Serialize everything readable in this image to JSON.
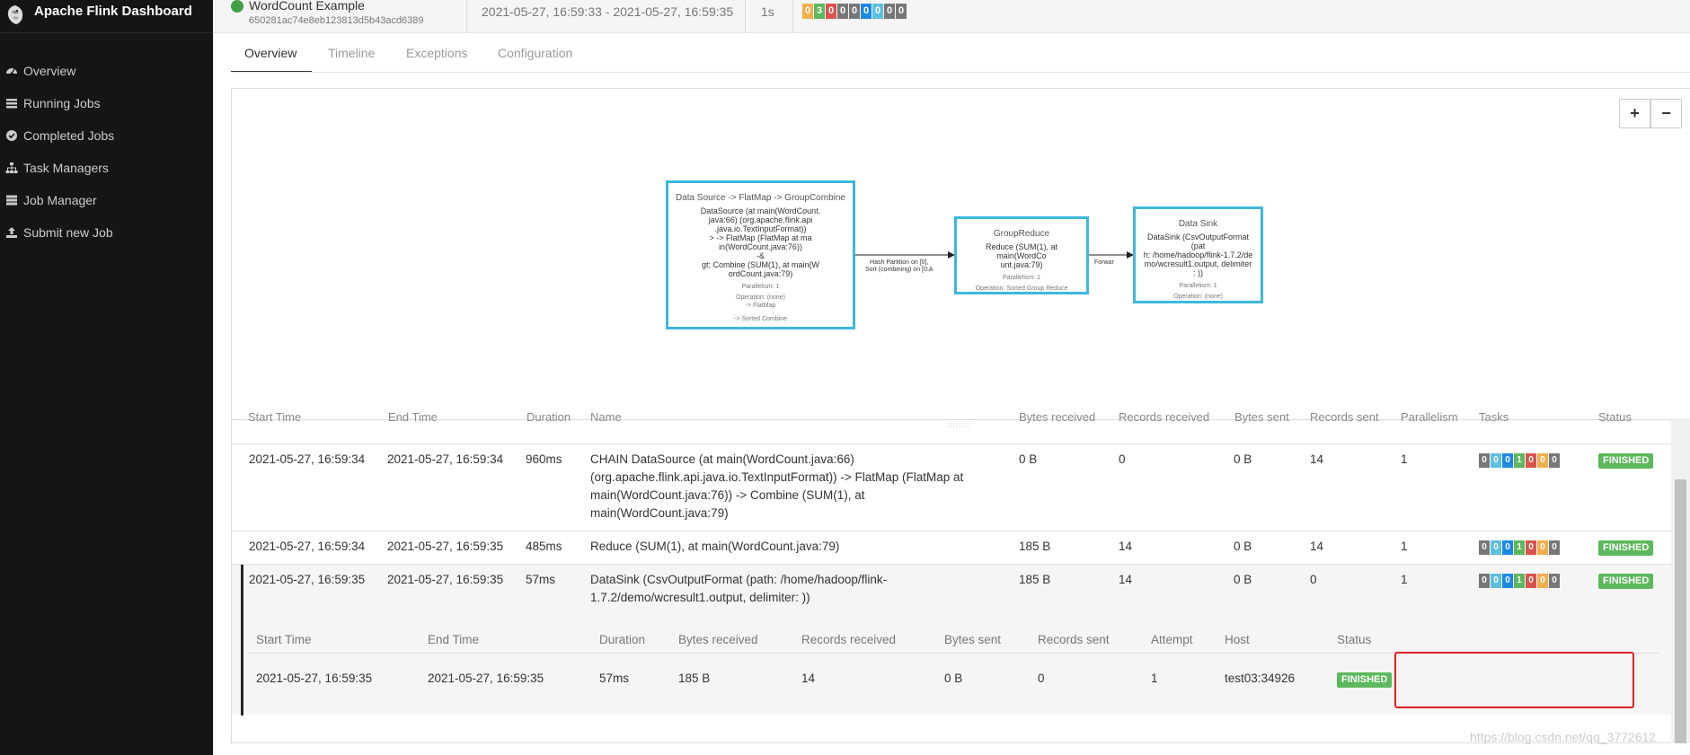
{
  "app": {
    "title": "Apache Flink Dashboard"
  },
  "sidebar": {
    "items": [
      {
        "label": "Overview",
        "icon": "dashboard-icon"
      },
      {
        "label": "Running Jobs",
        "icon": "tasks-icon"
      },
      {
        "label": "Completed Jobs",
        "icon": "check-circle-icon"
      },
      {
        "label": "Task Managers",
        "icon": "sitemap-icon"
      },
      {
        "label": "Job Manager",
        "icon": "server-icon"
      },
      {
        "label": "Submit new Job",
        "icon": "upload-icon"
      }
    ]
  },
  "job": {
    "name": "WordCount Example",
    "id": "650281ac74e8eb123813d5b43acd6389",
    "time_range": "2021-05-27, 16:59:33 - 2021-05-27, 16:59:35",
    "duration": "1s",
    "status_color": "#43a047",
    "counts": [
      {
        "value": "0",
        "color": "#f0ad4e"
      },
      {
        "value": "3",
        "color": "#5cb85c"
      },
      {
        "value": "0",
        "color": "#d9534f"
      },
      {
        "value": "0",
        "color": "#777777"
      },
      {
        "value": "0",
        "color": "#777777"
      },
      {
        "value": "0",
        "color": "#1e88e5"
      },
      {
        "value": "0",
        "color": "#5bc0de"
      },
      {
        "value": "0",
        "color": "#777777"
      },
      {
        "value": "0",
        "color": "#777777"
      }
    ]
  },
  "tabs": [
    {
      "label": "Overview",
      "active": true
    },
    {
      "label": "Timeline",
      "active": false
    },
    {
      "label": "Exceptions",
      "active": false
    },
    {
      "label": "Configuration",
      "active": false
    }
  ],
  "graph": {
    "zoom_in": "+",
    "zoom_out": "−",
    "nodes": [
      {
        "title": "Data Source -> FlatMap -> GroupCombine",
        "desc": "DataSource (at main(WordCount.java:66) (org.apache.flink.api.java.io.TextInputFormat)) -> FlatMap (FlatMap at main(WordCount.java:76)) -> Combine (SUM(1), at main(WordCount.java:79)",
        "desc_lines": [
          "DataSource (at main(WordCount.",
          "java:66) (org.apache.flink.api",
          ".java.io.TextInputFormat))",
          "> -> FlatMap (FlatMap at ma",
          "in(WordCount.java:76))",
          "-&",
          "gt; Combine (SUM(1), at main(W",
          "ordCount.java:79)"
        ],
        "parallelism": "Parallelism: 1",
        "operation_lines": [
          "Operation: (none)",
          "-> FlatMap",
          "",
          "-> Sorted Combine"
        ]
      },
      {
        "title": "GroupReduce",
        "desc_lines": [
          "Reduce (SUM(1), at main(WordCo",
          "unt.java:79)"
        ],
        "parallelism": "Parallelism: 1",
        "operation_lines": [
          "Operation: Sorted Group Reduce"
        ]
      },
      {
        "title": "Data Sink",
        "desc_lines": [
          "DataSink (CsvOutputFormat (pat",
          "h: /home/hadoop/flink-1.7.2/de",
          "mo/wcresult1.output, delimiter",
          ": ))"
        ],
        "parallelism": "Parallelism: 1",
        "operation_lines": [
          "Operation: (none)"
        ]
      }
    ],
    "edges": [
      {
        "label_lines": [
          "Hash Partition on [0],",
          "Sort (combining) on [0:A"
        ]
      },
      {
        "label_lines": [
          "Forwar"
        ]
      }
    ]
  },
  "table": {
    "headers": [
      "Start Time",
      "End Time",
      "Duration",
      "Name",
      "Bytes received",
      "Records received",
      "Bytes sent",
      "Records sent",
      "Parallelism",
      "Tasks",
      "Status"
    ],
    "task_colors": [
      "#777777",
      "#5bc0de",
      "#1e88e5",
      "#5cb85c",
      "#d9534f",
      "#f0ad4e",
      "#777777"
    ],
    "rows": [
      {
        "start": "2021-05-27, 16:59:34",
        "end": "2021-05-27, 16:59:34",
        "duration": "960ms",
        "name_lines": [
          "CHAIN DataSource (at main(WordCount.java:66)",
          "(org.apache.flink.api.java.io.TextInputFormat)) -> FlatMap (FlatMap at",
          "main(WordCount.java:76)) -> Combine (SUM(1), at",
          "main(WordCount.java:79)"
        ],
        "bytes_received": "0 B",
        "records_received": "0",
        "bytes_sent": "0 B",
        "records_sent": "14",
        "parallelism": "1",
        "tasks": [
          "0",
          "0",
          "0",
          "1",
          "0",
          "0",
          "0"
        ],
        "status": "FINISHED"
      },
      {
        "start": "2021-05-27, 16:59:34",
        "end": "2021-05-27, 16:59:35",
        "duration": "485ms",
        "name_lines": [
          "Reduce (SUM(1), at main(WordCount.java:79)"
        ],
        "bytes_received": "185 B",
        "records_received": "14",
        "bytes_sent": "0 B",
        "records_sent": "14",
        "parallelism": "1",
        "tasks": [
          "0",
          "0",
          "0",
          "1",
          "0",
          "0",
          "0"
        ],
        "status": "FINISHED"
      },
      {
        "start": "2021-05-27, 16:59:35",
        "end": "2021-05-27, 16:59:35",
        "duration": "57ms",
        "name_lines": [
          "DataSink (CsvOutputFormat (path: /home/hadoop/flink-",
          "1.7.2/demo/wcresult1.output, delimiter:  ))"
        ],
        "bytes_received": "185 B",
        "records_received": "14",
        "bytes_sent": "0 B",
        "records_sent": "0",
        "parallelism": "1",
        "tasks": [
          "0",
          "0",
          "0",
          "1",
          "0",
          "0",
          "0"
        ],
        "status": "FINISHED"
      }
    ],
    "subtask": {
      "headers": [
        "Start Time",
        "End Time",
        "Duration",
        "Bytes received",
        "Records received",
        "Bytes sent",
        "Records sent",
        "Attempt",
        "Host",
        "Status"
      ],
      "row": {
        "start": "2021-05-27, 16:59:35",
        "end": "2021-05-27, 16:59:35",
        "duration": "57ms",
        "bytes_received": "185 B",
        "records_received": "14",
        "bytes_sent": "0 B",
        "records_sent": "0",
        "attempt": "1",
        "host": "test03:34926",
        "status": "FINISHED"
      }
    }
  },
  "watermark": "https://blog.csdn.net/qq_3772612"
}
